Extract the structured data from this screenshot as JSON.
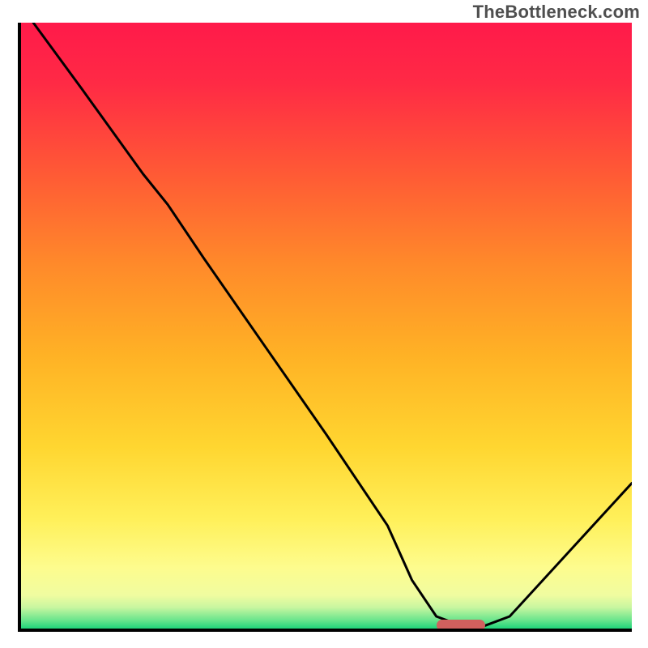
{
  "watermark": "TheBottleneck.com",
  "chart_data": {
    "type": "line",
    "title": "",
    "xlabel": "",
    "ylabel": "",
    "xlim": [
      0,
      100
    ],
    "ylim": [
      0,
      100
    ],
    "series": [
      {
        "name": "curve",
        "x": [
          2,
          10,
          20,
          24,
          30,
          40,
          50,
          60,
          64,
          68,
          72,
          76,
          80,
          100
        ],
        "y": [
          100,
          89,
          75,
          70,
          61,
          46.5,
          32,
          17,
          8,
          2,
          0.5,
          0.5,
          2,
          24
        ]
      }
    ],
    "marker": {
      "x_start": 68,
      "x_end": 76,
      "y": 0.5,
      "color": "#d1605e"
    },
    "background_gradient": {
      "stops": [
        {
          "offset": 0.0,
          "color": "#ff1a4a"
        },
        {
          "offset": 0.1,
          "color": "#ff2a45"
        },
        {
          "offset": 0.25,
          "color": "#ff5a35"
        },
        {
          "offset": 0.4,
          "color": "#ff8a2a"
        },
        {
          "offset": 0.55,
          "color": "#ffb225"
        },
        {
          "offset": 0.7,
          "color": "#ffd630"
        },
        {
          "offset": 0.82,
          "color": "#fff05a"
        },
        {
          "offset": 0.9,
          "color": "#fdfc8e"
        },
        {
          "offset": 0.945,
          "color": "#f0fca0"
        },
        {
          "offset": 0.965,
          "color": "#c8f6a0"
        },
        {
          "offset": 0.985,
          "color": "#6fe68e"
        },
        {
          "offset": 1.0,
          "color": "#1fd47a"
        }
      ]
    }
  }
}
